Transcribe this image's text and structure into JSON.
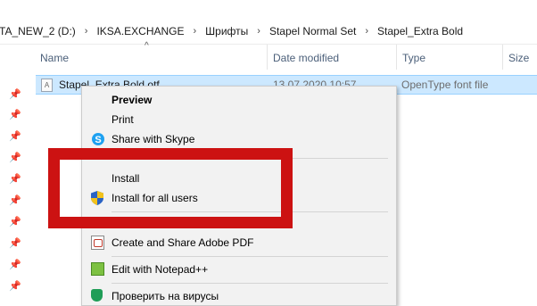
{
  "breadcrumb": {
    "items": [
      "TA_NEW_2 (D:)",
      "IKSA.EXCHANGE",
      "Шрифты",
      "Stapel Normal Set",
      "Stapel_Extra Bold"
    ],
    "separator": "›"
  },
  "columns": {
    "name": "Name",
    "date_modified": "Date modified",
    "type": "Type",
    "size": "Size"
  },
  "file": {
    "name": "Stapel_Extra Bold.otf",
    "date_modified": "13.07.2020 10:57",
    "type": "OpenType font file"
  },
  "context_menu": {
    "items": [
      {
        "label": "Preview",
        "icon": "none"
      },
      {
        "label": "Print",
        "icon": "none"
      },
      {
        "label": "Share with Skype",
        "icon": "skype-icon"
      },
      {
        "label": "Install",
        "icon": "none"
      },
      {
        "label": "Install for all users",
        "icon": "uac-shield-icon"
      },
      {
        "label": "Create and Share Adobe PDF",
        "icon": "adobe-pdf-icon"
      },
      {
        "label": "Edit with Notepad++",
        "icon": "notepad-plus-plus-icon"
      },
      {
        "label": "Проверить на вирусы",
        "icon": "antivirus-shield-icon"
      }
    ]
  },
  "colors": {
    "selection": "#cce8ff",
    "highlight_frame": "#cc1212",
    "skype": "#1ea1f1"
  }
}
